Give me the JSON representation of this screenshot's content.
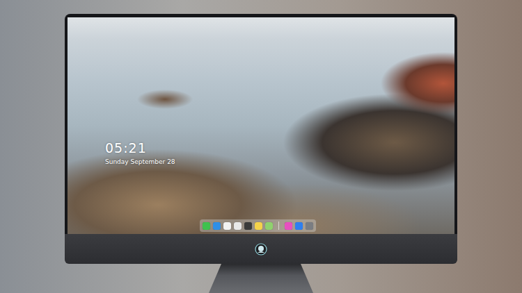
{
  "screen": {
    "clock": {
      "time": "05:21",
      "date": "Sunday September 28"
    },
    "dock": {
      "items": [
        {
          "color": "#3ec14e"
        },
        {
          "color": "#2f8fe6"
        },
        {
          "color": "#f2f2f2"
        },
        {
          "color": "#e9e9e9"
        },
        {
          "color": "#3a3a3a"
        },
        {
          "color": "#f5d24a"
        },
        {
          "color": "#8fd16e"
        },
        {
          "color": "#e84fbf"
        },
        {
          "color": "#2e7ff0"
        },
        {
          "color": "#7a7d82"
        }
      ]
    }
  }
}
